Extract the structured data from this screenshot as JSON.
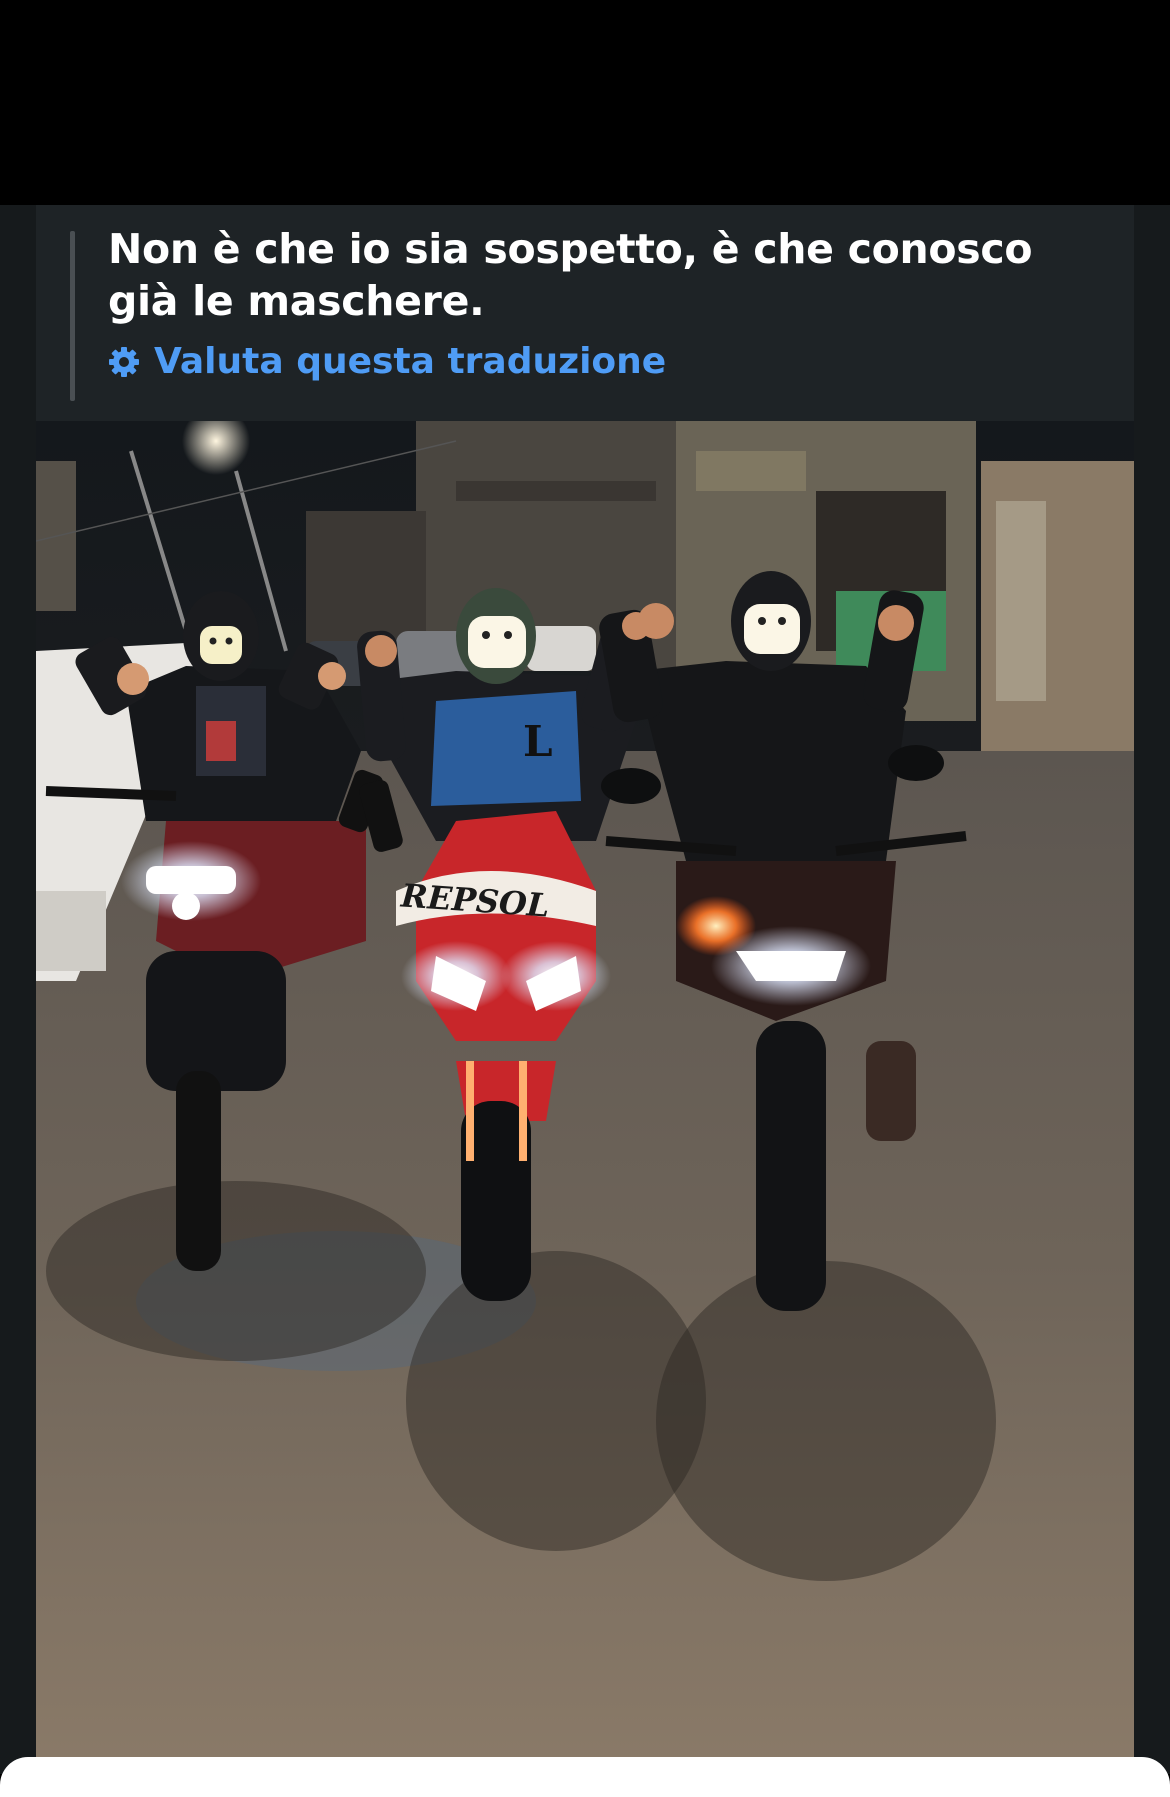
{
  "post": {
    "caption": "Non è che io sia sospetto, è che conosco già le maschere.",
    "translation_link": "Valuta questa traduzione",
    "translation_icon": "gear-icon"
  },
  "photo": {
    "subject": "three riders on motorcycles at night on a street, faces hidden with emoji stickers",
    "fairing_text": "REPSOL",
    "jacket_letter": "L"
  },
  "colors": {
    "link": "#4f9cf5",
    "post_background": "#1c2124"
  }
}
